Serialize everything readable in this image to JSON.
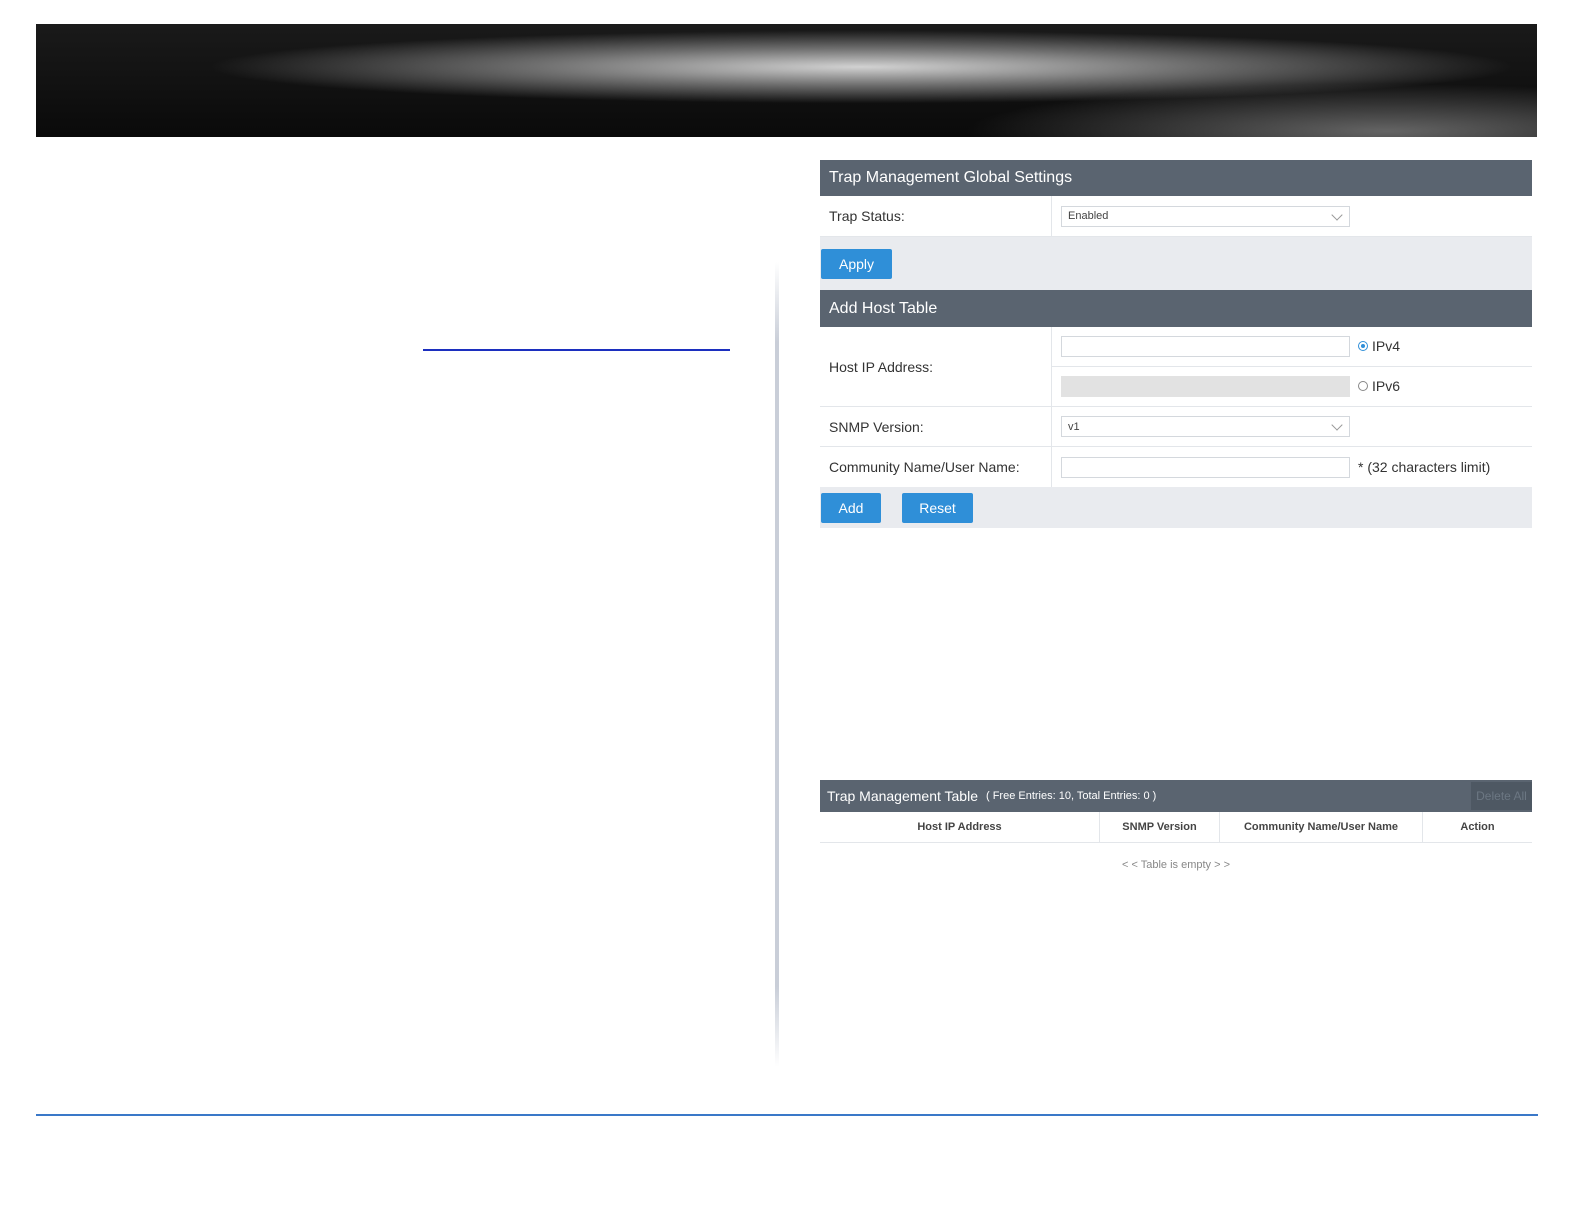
{
  "global_settings": {
    "title": "Trap Management Global Settings",
    "trap_status_label": "Trap Status:",
    "trap_status_value": "Enabled",
    "apply_label": "Apply"
  },
  "add_host": {
    "title": "Add Host Table",
    "host_ip_label": "Host IP Address:",
    "ipv4_label": "IPv4",
    "ipv6_label": "IPv6",
    "ip_mode_selected": "IPv4",
    "snmp_version_label": "SNMP Version:",
    "snmp_version_value": "v1",
    "community_label": "Community Name/User Name:",
    "community_hint": "* (32 characters limit)",
    "add_label": "Add",
    "reset_label": "Reset"
  },
  "trap_table": {
    "title": "Trap Management Table",
    "entries_info": "( Free Entries: 10, Total Entries: 0 )",
    "delete_all_label": "Delete All",
    "columns": [
      "Host IP Address",
      "SNMP Version",
      "Community Name/User Name",
      "Action"
    ],
    "empty_message": "< < Table is empty > >"
  },
  "colors": {
    "header_bar": "#5a6470",
    "button_blue": "#2f8fd8",
    "button_bar_bg": "#e9ebef",
    "footer_line": "#3a78c8"
  }
}
